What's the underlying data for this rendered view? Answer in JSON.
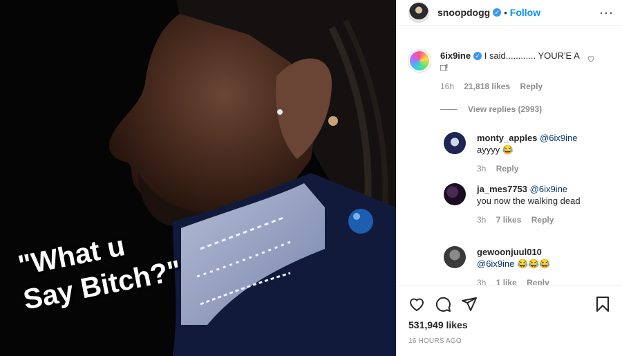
{
  "photo": {
    "caption_line1": "\"What u",
    "caption_line2": "Say Bitch?\""
  },
  "header": {
    "username": "snoopdogg",
    "separator": "•",
    "follow_label": "Follow",
    "more_label": "···"
  },
  "comments": [
    {
      "username": "6ix9ine",
      "text": "I said............ YOUR'E A",
      "text_line2": "□!",
      "time": "16h",
      "likes": "21,818 likes",
      "reply_label": "Reply",
      "view_replies": "View replies (2993)"
    }
  ],
  "replies": [
    {
      "username": "monty_apples",
      "mention": "@6ix9ine",
      "text": "ayyyy 😂",
      "time": "3h",
      "reply_label": "Reply"
    },
    {
      "username": "ja_mes7753",
      "mention": "@6ix9ine",
      "text": "you now the walking dead",
      "time": "3h",
      "likes": "7 likes",
      "reply_label": "Reply"
    },
    {
      "username": "gewoonjuul010",
      "mention": "@6ix9ine",
      "text": "😂😂😂",
      "time": "3h",
      "likes": "1 like",
      "reply_label": "Reply"
    }
  ],
  "post": {
    "likes": "531,949 likes",
    "time": "16 HOURS AGO"
  },
  "icons": {
    "like": "heart-icon",
    "comment": "comment-icon",
    "share": "share-icon",
    "save": "bookmark-icon",
    "verified": "verified-badge-icon"
  },
  "colors": {
    "link": "#0095f6",
    "verified": "#3897f0",
    "mention": "#00376b",
    "secondary_text": "#8e8e8e"
  }
}
